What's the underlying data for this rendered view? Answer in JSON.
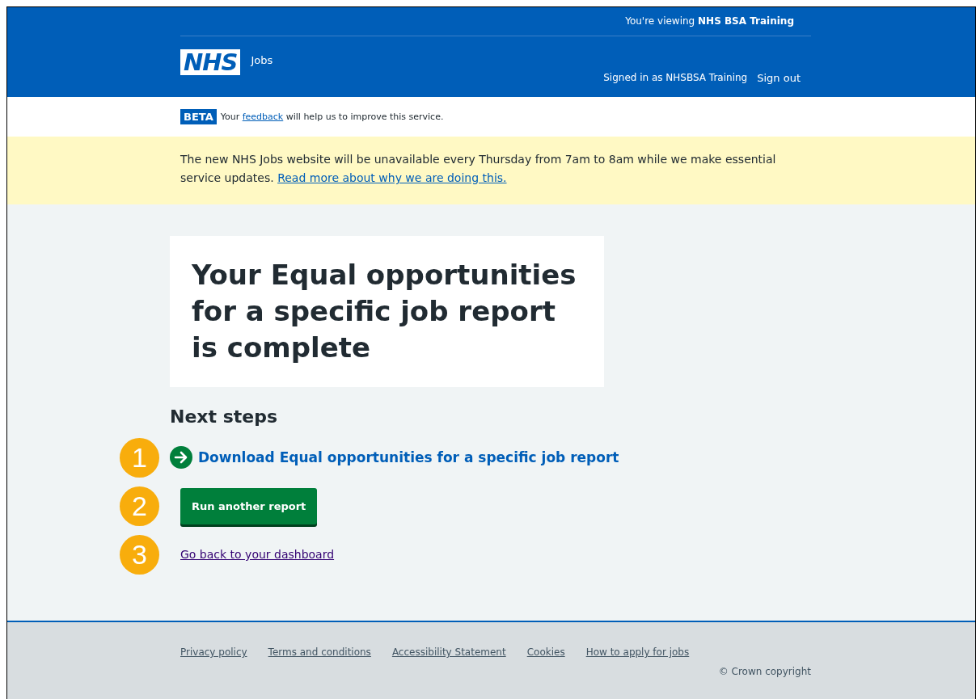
{
  "header": {
    "viewing": "You're viewing **NHS BSA Training**",
    "logo": "NHS",
    "service": "Jobs",
    "signed_in": "Signed in as NHSBSA Training",
    "sign_out": "Sign out"
  },
  "phase_banner": {
    "tag": "BETA",
    "before": "Your",
    "link": "feedback",
    "after": "will help us to improve this service."
  },
  "notice": {
    "text": "The new NHS Jobs website will be unavailable every Thursday from 7am to 8am while we make essential service updates.",
    "link": "Read more about why we are doing this."
  },
  "panel": {
    "title": "Your Equal opportunities for a specific job report is complete"
  },
  "next_steps": {
    "heading": "Next steps",
    "items": [
      {
        "kind": "action-link",
        "label": "Download Equal opportunities for a specific job report",
        "marker": "1"
      },
      {
        "kind": "button",
        "label": "Run another report",
        "marker": "2"
      },
      {
        "kind": "link",
        "label": "Go back to your dashboard",
        "marker": "3"
      }
    ]
  },
  "footer": {
    "links": [
      "Privacy policy",
      "Terms and conditions",
      "Accessibility Statement",
      "Cookies",
      "How to apply for jobs"
    ],
    "copyright": "© Crown copyright"
  }
}
